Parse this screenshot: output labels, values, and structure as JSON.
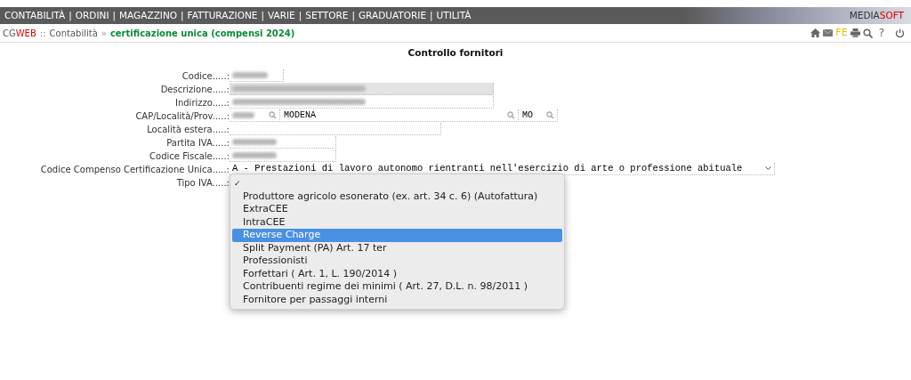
{
  "menu_bar": {
    "items": [
      "CONTABILITÀ",
      "ORDINI",
      "MAGAZZINO",
      "FATTURAZIONE",
      "VARIE",
      "SETTORE",
      "GRADUATORIE",
      "UTILITÀ"
    ],
    "separator": "|",
    "brand": {
      "part_1": "MEDIA",
      "part_2": "SOFT"
    }
  },
  "breadcrumb": {
    "app_part_1": "CG",
    "app_part_2": "WEB",
    "separator_1": "::",
    "section": "Contabilità",
    "separator_2": "»",
    "page": "certificazione unica (compensi 2024)"
  },
  "toolbar": {
    "fe_label": "FE",
    "help_label": "?"
  },
  "title": "Controllo fornitori",
  "fields": [
    {
      "kind": "short",
      "label": "Codice.....:",
      "blurred": true
    },
    {
      "kind": "wide",
      "label": "Descrizione.....:",
      "blurred": true,
      "disabled": true
    },
    {
      "kind": "wide",
      "label": "Indirizzo.....:",
      "blurred": true,
      "disabled": false
    },
    {
      "kind": "location",
      "label": "CAP/Località/Prov.....:",
      "cap_blurred": true,
      "city": "MODENA",
      "province": "MO"
    },
    {
      "kind": "medium",
      "label": "Località estera.....:",
      "blurred": false
    },
    {
      "kind": "narrow",
      "label": "Partita IVA.....:",
      "blurred": true
    },
    {
      "kind": "narrow",
      "label": "Codice Fiscale.....:",
      "blurred": true
    },
    {
      "kind": "select",
      "label": "Codice Compenso Certificazione Unica.....:",
      "value": "A - Prestazioni di lavoro autonomo rientranti nell'esercizio di arte o professione abituale"
    },
    {
      "kind": "open_select",
      "label": "Tipo IVA.....:"
    }
  ],
  "dropdown": {
    "check_mark": "✓",
    "options": [
      {
        "checked": true,
        "selected": false
      },
      {
        "label": "Produttore agricolo esonerato (ex. art. 34 c. 6) (Autofattura)",
        "checked": false,
        "selected": false
      },
      {
        "label": "ExtraCEE",
        "checked": false,
        "selected": false
      },
      {
        "label": "IntraCEE",
        "checked": false,
        "selected": false
      },
      {
        "label": "Reverse Charge",
        "checked": false,
        "selected": true
      },
      {
        "label": "Split Payment (PA) Art. 17 ter",
        "checked": false,
        "selected": false
      },
      {
        "label": "Professionisti",
        "checked": false,
        "selected": false
      },
      {
        "label": "Forfettari ( Art. 1, L. 190/2014 )",
        "checked": false,
        "selected": false
      },
      {
        "label": "Contribuenti regime dei minimi ( Art. 27, D.L. n. 98/2011 )",
        "checked": false,
        "selected": false
      },
      {
        "label": "Fornitore per passaggi interni",
        "checked": false,
        "selected": false
      }
    ]
  }
}
